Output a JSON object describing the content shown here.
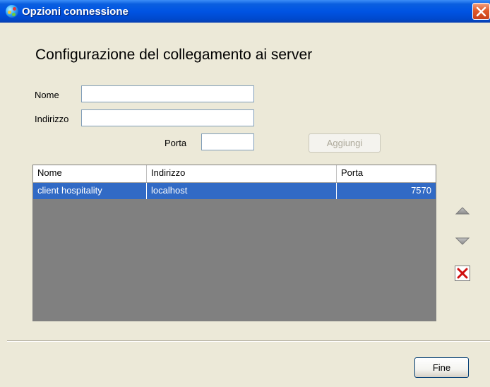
{
  "window": {
    "title": "Opzioni connessione"
  },
  "heading": "Configurazione del collegamento ai server",
  "form": {
    "name_label": "Nome",
    "name_value": "",
    "address_label": "Indirizzo",
    "address_value": "",
    "port_label": "Porta",
    "port_value": "",
    "add_button": "Aggiungi"
  },
  "table": {
    "columns": [
      "Nome",
      "Indirizzo",
      "Porta"
    ],
    "rows": [
      {
        "name": "client hospitality",
        "address": "localhost",
        "port": "7570"
      }
    ]
  },
  "side_buttons": [
    "arrow-up-icon",
    "arrow-down-icon",
    "delete-icon"
  ],
  "footer": {
    "finish_button": "Fine"
  },
  "colors": {
    "titlebar": "#0054e3",
    "selection": "#316ac5",
    "window_bg": "#ece9d8",
    "list_bg": "#808080",
    "delete_red": "#d01010"
  }
}
